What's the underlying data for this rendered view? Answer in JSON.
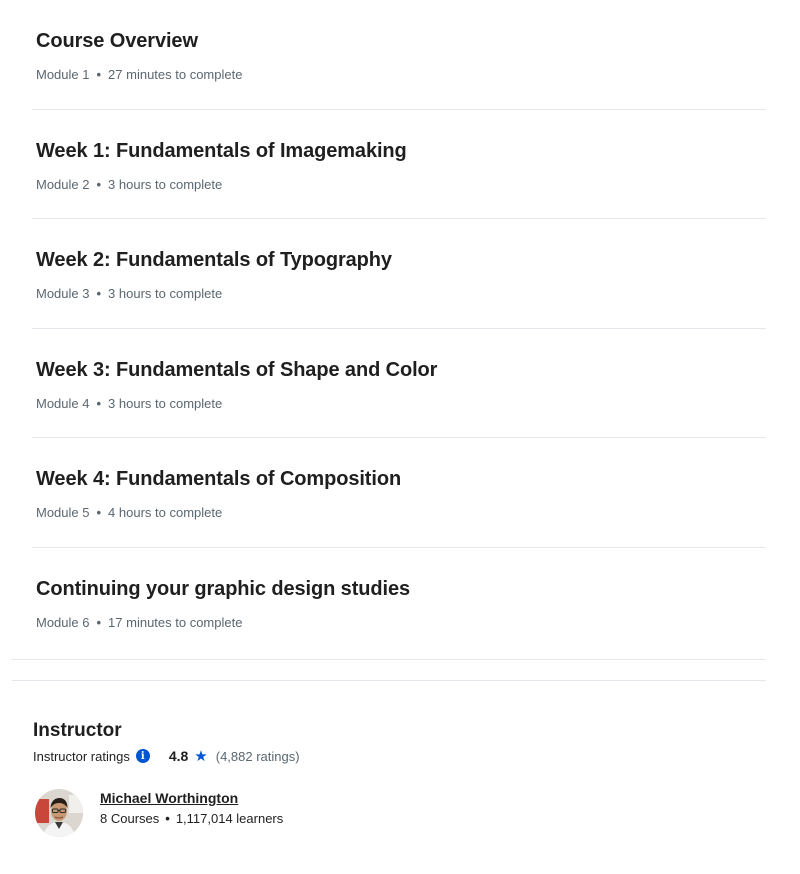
{
  "modules": [
    {
      "title": "Course Overview",
      "module_label": "Module 1",
      "duration": "27 minutes to complete"
    },
    {
      "title": "Week 1: Fundamentals of Imagemaking",
      "module_label": "Module 2",
      "duration": "3 hours to complete"
    },
    {
      "title": "Week 2: Fundamentals of Typography",
      "module_label": "Module 3",
      "duration": "3 hours to complete"
    },
    {
      "title": "Week 3: Fundamentals of Shape and Color",
      "module_label": "Module 4",
      "duration": "3 hours to complete"
    },
    {
      "title": "Week 4: Fundamentals of Composition",
      "module_label": "Module 5",
      "duration": "4 hours to complete"
    },
    {
      "title": "Continuing your graphic design studies",
      "module_label": "Module 6",
      "duration": "17 minutes to complete"
    }
  ],
  "separator": "•",
  "instructor": {
    "heading": "Instructor",
    "ratings_label": "Instructor ratings",
    "info_icon": "info-icon",
    "rating_value": "4.8",
    "star_icon": "star-icon",
    "rating_count": "(4,882 ratings)",
    "name": "Michael Worthington",
    "courses": "8 Courses",
    "learners": "1,117,014 learners"
  },
  "colors": {
    "accent": "#0056d2",
    "text": "#1f1f1f",
    "muted": "#5b6770",
    "divider": "#e3e6ea"
  }
}
